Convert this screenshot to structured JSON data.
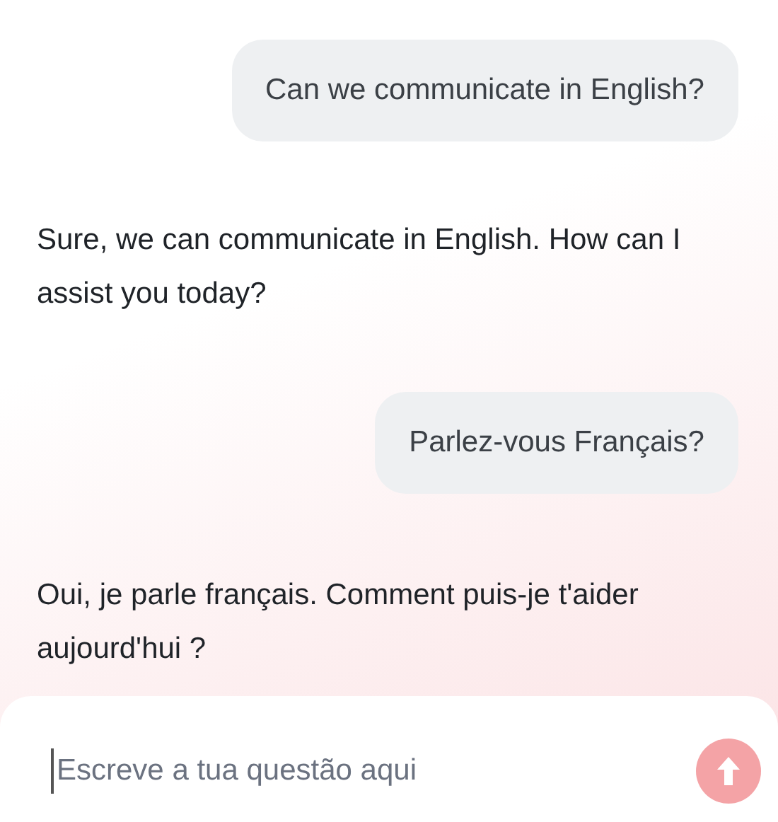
{
  "messages": [
    {
      "kind": "user",
      "text": "Can we communicate in English?"
    },
    {
      "kind": "assistant",
      "text": "Sure, we can communicate in English. How can I assist you today?"
    },
    {
      "kind": "user",
      "text": "Parlez-vous Français?"
    },
    {
      "kind": "assistant",
      "text": "Oui, je parle français. Comment puis-je t'aider aujourd'hui ?"
    }
  ],
  "composer": {
    "placeholder": "Escreve a tua questão aqui"
  }
}
